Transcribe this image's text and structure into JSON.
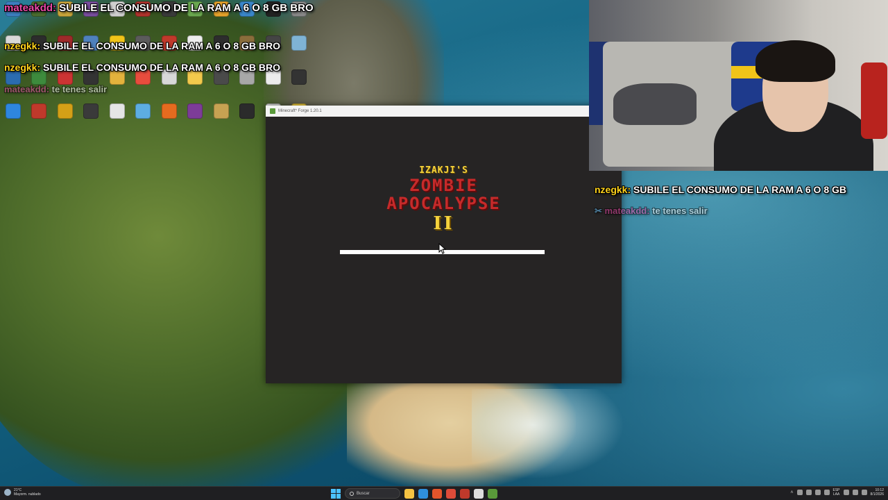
{
  "colors": {
    "chat_user": "#ffd21a",
    "chat_user_pink": "#e94aa6",
    "logo_yellow": "#f4d23c",
    "logo_red": "#c62a2a",
    "mc_background": "#262424"
  },
  "chat": {
    "line1_user": "mateakdd:",
    "line1_text": "SUBILE EL CONSUMO DE LA RAM A 6 O 8 GB BRO",
    "line2_user": "nzegkk:",
    "line2_text": "SUBILE EL CONSUMO DE LA RAM A 6 O 8 GB BRO",
    "line3_user": "nzegkk:",
    "line3_text": "SUBILE EL CONSUMO DE LA RAM A 6 O 8 GB BRO",
    "line4_user": "mateakdd:",
    "line4_text": "te tenes",
    "line4_tail": "salir",
    "right_line1_user": "nzegkk:",
    "right_line1_text": "SUBILE EL CONSUMO DE LA RAM A 6 O 8 GB",
    "right_line2_user": "mateakdd:",
    "right_line2_text": "te tenes",
    "right_line2_tail": "salir"
  },
  "minecraft": {
    "window_title": "Minecraft* Forge 1.20.1",
    "logo_top": "IZAKJI'S",
    "logo_line1": "ZOMBIE",
    "logo_line2": "APOCALYPSE",
    "logo_number": "II",
    "progress": 1.0
  },
  "desktop": {
    "icons": [
      {
        "label": "",
        "color": "#3c7fbf"
      },
      {
        "label": "",
        "color": "#4a6d2f"
      },
      {
        "label": "",
        "color": "#c9a43a"
      },
      {
        "label": "",
        "color": "#7a4ea0"
      },
      {
        "label": "",
        "color": "#cfcfcf"
      },
      {
        "label": "",
        "color": "#b0332c"
      },
      {
        "label": "",
        "color": "#3a3a3a"
      },
      {
        "label": "",
        "color": "#6aa84f"
      },
      {
        "label": "",
        "color": "#e5a22b"
      },
      {
        "label": "",
        "color": "#3a86c9"
      },
      {
        "label": "",
        "color": "#222222"
      },
      {
        "label": "",
        "color": "#888888"
      },
      {
        "label": "",
        "color": "#d9d9d9"
      },
      {
        "label": "",
        "color": "#2c2c2c"
      },
      {
        "label": "",
        "color": "#9e2a2a"
      },
      {
        "label": "",
        "color": "#4f81bd"
      },
      {
        "label": "",
        "color": "#f0c419"
      },
      {
        "label": "",
        "color": "#5b5b5b"
      },
      {
        "label": "",
        "color": "#c0392b"
      },
      {
        "label": "",
        "color": "#eeeeee"
      },
      {
        "label": "",
        "color": "#2d2d2d"
      },
      {
        "label": "",
        "color": "#8a6d3b"
      },
      {
        "label": "",
        "color": "#444444"
      },
      {
        "label": "",
        "color": "#7fb3d5"
      },
      {
        "label": "",
        "color": "#2b6cb0"
      },
      {
        "label": "",
        "color": "#3d8b3d"
      },
      {
        "label": "",
        "color": "#cc3333"
      },
      {
        "label": "",
        "color": "#333333"
      },
      {
        "label": "",
        "color": "#e3b23c"
      },
      {
        "label": "",
        "color": "#e84c3d"
      },
      {
        "label": "",
        "color": "#d8d8d8"
      },
      {
        "label": "",
        "color": "#f2c94c"
      },
      {
        "label": "",
        "color": "#4a4a4a"
      },
      {
        "label": "",
        "color": "#a8a8a8"
      },
      {
        "label": "",
        "color": "#ececec"
      },
      {
        "label": "",
        "color": "#333333"
      },
      {
        "label": "",
        "color": "#2e86de"
      },
      {
        "label": "",
        "color": "#c0392b"
      },
      {
        "label": "",
        "color": "#d4a017"
      },
      {
        "label": "",
        "color": "#3a3a3a"
      },
      {
        "label": "",
        "color": "#e5e5e5"
      },
      {
        "label": "",
        "color": "#5dade2"
      },
      {
        "label": "",
        "color": "#e56b1f"
      },
      {
        "label": "",
        "color": "#7d3c98"
      },
      {
        "label": "",
        "color": "#c7a252"
      },
      {
        "label": "",
        "color": "#2b2b2b"
      },
      {
        "label": "",
        "color": "#e0e0e0"
      },
      {
        "label": "",
        "color": "#f4d03f"
      }
    ]
  },
  "taskbar": {
    "weather_temp": "21°C",
    "weather_desc": "Mayorm. nublado",
    "search_placeholder": "Buscar",
    "lang_top": "ESP",
    "lang_bottom": "LAA",
    "time": "10:12",
    "date": "8/1/2026",
    "apps": [
      {
        "name": "file-explorer",
        "color": "#f5c242"
      },
      {
        "name": "edge",
        "color": "#2f8fdc"
      },
      {
        "name": "brave",
        "color": "#e5552b"
      },
      {
        "name": "chrome",
        "color": "#dd4b39"
      },
      {
        "name": "app-red",
        "color": "#c0392b"
      },
      {
        "name": "capcut",
        "color": "#dddddd"
      },
      {
        "name": "minecraft",
        "color": "#5a9a3a"
      }
    ]
  }
}
